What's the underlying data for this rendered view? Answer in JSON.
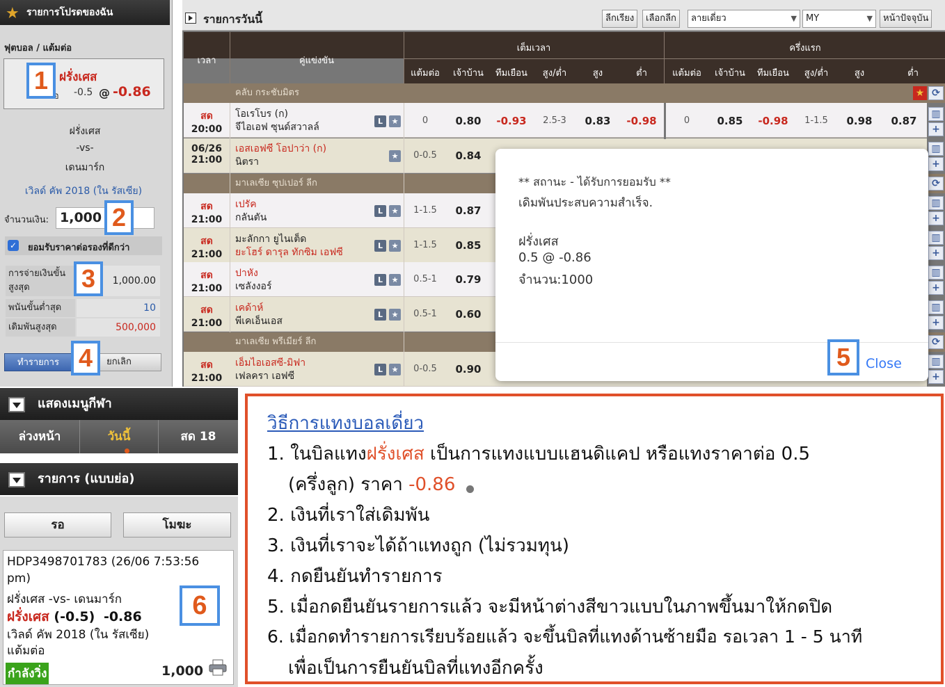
{
  "favorites": {
    "title": "รายการโปรดของฉัน"
  },
  "betslip": {
    "sport_type": "ฟุตบอล / แต้มต่อ",
    "selection_team": "ฝรั่งเศส",
    "selection_label": "แต้มต่อ",
    "selection_line": "-0.5",
    "selection_at": "@",
    "selection_price": "-0.86",
    "home": "ฝรั่งเศส",
    "vs": "-vs-",
    "away": "เดนมาร์ก",
    "league": "เวิลด์ คัพ 2018 (ใน รัสเซีย)",
    "amount_label": "จำนวนเงิน:",
    "amount_value": "1,000",
    "accept_better_label": "ยอมรับราคาต่อรองที่ดีกว่า",
    "accept_better_checked": true,
    "max_payout_label": "การจ่ายเงินขั้นสูงสุด",
    "max_payout_value": "1,000.00",
    "min_bet_label": "พนันขั้นต่ำสุด",
    "min_bet_value": "10",
    "max_bet_label": "เดิมพันสูงสุด",
    "max_bet_value": "500,000",
    "place_button": "ทำรายการ",
    "cancel_button": "ยกเลิก"
  },
  "callouts": [
    "1",
    "2",
    "3",
    "4",
    "5",
    "6"
  ],
  "sports_menu": {
    "title": "แสดงเมนูกีฬา",
    "tabs": [
      "ล่วงหน้า",
      "วันนี้",
      "สด 18"
    ],
    "active_tab": "วันนี้"
  },
  "mini_list": {
    "title": "รายการ (แบบย่อ)",
    "buttons": [
      "รอ",
      "โมฆะ"
    ],
    "ticket": {
      "id_line": "HDP3498701783 (26/06 7:53:56",
      "id_line2": "pm)",
      "match": "ฝรั่งเศส -vs- เดนมาร์ก",
      "pick_team": "ฝรั่งเศส",
      "pick_line": "(-0.5)",
      "pick_price": "-0.86",
      "league": "เวิลด์ คัพ 2018 (ใน รัสเซีย)",
      "bet_type": "แต้มต่อ",
      "status": "กำลังวิ่ง",
      "amount": "1,000"
    }
  },
  "odds": {
    "title": "รายการวันนี้",
    "toolbar": {
      "select_league": "ลีกเรียง",
      "choose_league": "เลือกลีก",
      "mode": "ลายเดี่ยว",
      "odds_type": "MY",
      "current_page": "หน้าปัจจุบัน"
    },
    "headers": {
      "time": "เวลา",
      "match": "คู่แข่งขัน",
      "full_time": "เต็มเวลา",
      "first_half": "ครึ่งแรก",
      "cols": [
        "แต้มต่อ",
        "เจ้าบ้าน",
        "ทีมเยือน",
        "สูง/ต่ำ",
        "สูง",
        "ต่ำ"
      ]
    },
    "leagues": [
      "คลับ กระชับมิตร",
      "มาเลเซีย ซุปเปอร์ ลีก",
      "มาเลเซีย พรีเมียร์ ลีก"
    ],
    "rows": [
      {
        "live": "สด",
        "time": "20:00",
        "home": "โอเรโบร (ก)",
        "away": "จีไอเอฟ ซุนด์สวาลล์",
        "hdp": "0",
        "h": "0.80",
        "a": "-0.93",
        "ou": "2.5-3",
        "o": "0.83",
        "u": "-0.98",
        "fh_hdp": "0",
        "fh_h": "0.85",
        "fh_a": "-0.98",
        "fh_ou": "1-1.5",
        "fh_o": "0.98",
        "fh_u": "0.87"
      },
      {
        "live": "06/26",
        "time": "21:00",
        "home": "เอสเอฟซี โอปาว่า (ก)",
        "away": "นิตรา",
        "hdp": "0-0.5",
        "h": "0.84"
      },
      {
        "live": "สด",
        "time": "21:00",
        "home": "เปรัค",
        "away": "กลันตัน",
        "hdp": "1-1.5",
        "h": "0.87"
      },
      {
        "live": "สด",
        "time": "21:00",
        "home": "มะลักกา ยูไนเต็ด",
        "away": "ยะโฮร์ ดารุล ทักซิม เอฟซี",
        "hdp": "1-1.5",
        "h": "0.85"
      },
      {
        "live": "สด",
        "time": "21:00",
        "home": "ปาหัง",
        "away": "เซลังงอร์",
        "hdp": "0.5-1",
        "h": "0.79"
      },
      {
        "live": "สด",
        "time": "21:00",
        "home": "เคด้าห์",
        "away": "พีเคเอ็นเอส",
        "hdp": "0.5-1",
        "h": "0.60"
      },
      {
        "live": "สด",
        "time": "21:00",
        "home": "เอ็มไอเอสซี-มิฟา",
        "away": "เฟลครา เอฟซี",
        "hdp": "0-0.5",
        "h": "0.90"
      }
    ]
  },
  "modal": {
    "status": "** สถานะ - ได้รับการยอมรับ **",
    "message": "เดิมพันประสบความสำเร็จ.",
    "team": "ฝรั่งเศส",
    "line": "0.5 @ -0.86",
    "amount": "จำนวน:1000",
    "close": "Close"
  },
  "instructions": {
    "title": "วิธีการแทงบอลเดี่ยว",
    "step1_a": "1. ในบิลแทง",
    "step1_team": "ฝรั่งเศส",
    "step1_b": " เป็นการแทงแบบแฮนดิแคป หรือแทงราคาต่อ 0.5",
    "step1_c": "(ครึ่งลูก) ราคา ",
    "step1_price": "-0.86",
    "step2": "2. เงินที่เราใส่เดิมพัน",
    "step3": "3. เงินที่เราจะได้ถ้าแทงถูก (ไม่รวมทุน)",
    "step4": "4. กดยืนยันทำรายการ",
    "step5": "5. เมื่อกดยืนยันรายการแล้ว จะมีหน้าต่างสีขาวแบบในภาพขึ้นมาให้กดปิด",
    "step6_a": "6. เมื่อกดทำรายการเรียบร้อยแล้ว จะขึ้นบิลที่แทงด้านซ้ายมือ รอเวลา 1 - 5 นาที",
    "step6_b": "เพื่อเป็นการยืนยันบิลที่แทงอีกครั้ง"
  }
}
